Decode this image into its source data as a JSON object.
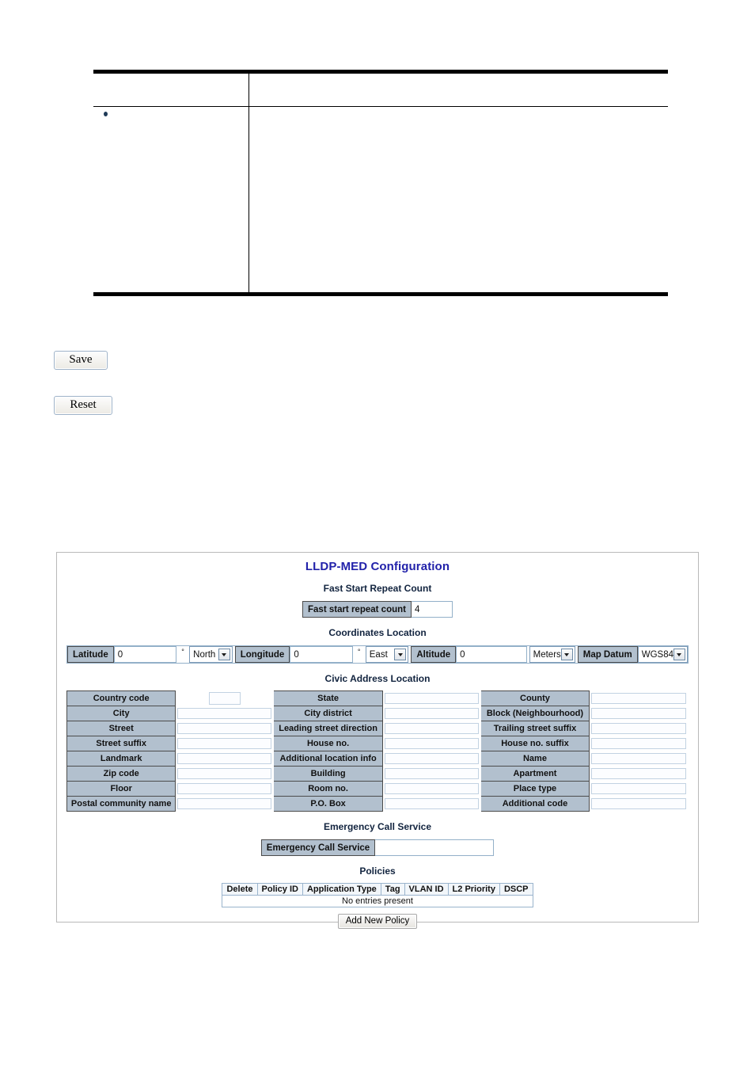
{
  "document_table": {
    "header_cells": [
      "",
      ""
    ],
    "body_rows": [
      {
        "bullet": "•",
        "left": "",
        "right": ""
      }
    ]
  },
  "actions": {
    "save_label": "Save",
    "reset_label": "Reset"
  },
  "panel": {
    "title": "LLDP-MED Configuration",
    "sections": {
      "fast_start": {
        "heading": "Fast Start Repeat Count",
        "field_label": "Fast start repeat count",
        "field_value": "4"
      },
      "coordinates": {
        "heading": "Coordinates Location",
        "latitude_label": "Latitude",
        "latitude_value": "0",
        "latitude_degree_symbol": "°",
        "latitude_direction": "North",
        "longitude_label": "Longitude",
        "longitude_value": "0",
        "longitude_degree_symbol": "°",
        "longitude_direction": "East",
        "altitude_label": "Altitude",
        "altitude_value": "0",
        "altitude_unit": "Meters",
        "map_datum_label": "Map Datum",
        "map_datum_value": "WGS84"
      },
      "civic": {
        "heading": "Civic Address Location",
        "rows": [
          {
            "c1": "Country code",
            "v1": "",
            "c2": "State",
            "v2": "",
            "c3": "County",
            "v3": ""
          },
          {
            "c1": "City",
            "v1": "",
            "c2": "City district",
            "v2": "",
            "c3": "Block (Neighbourhood)",
            "v3": ""
          },
          {
            "c1": "Street",
            "v1": "",
            "c2": "Leading street direction",
            "v2": "",
            "c3": "Trailing street suffix",
            "v3": ""
          },
          {
            "c1": "Street suffix",
            "v1": "",
            "c2": "House no.",
            "v2": "",
            "c3": "House no. suffix",
            "v3": ""
          },
          {
            "c1": "Landmark",
            "v1": "",
            "c2": "Additional location info",
            "v2": "",
            "c3": "Name",
            "v3": ""
          },
          {
            "c1": "Zip code",
            "v1": "",
            "c2": "Building",
            "v2": "",
            "c3": "Apartment",
            "v3": ""
          },
          {
            "c1": "Floor",
            "v1": "",
            "c2": "Room no.",
            "v2": "",
            "c3": "Place type",
            "v3": ""
          },
          {
            "c1": "Postal community name",
            "v1": "",
            "c2": "P.O. Box",
            "v2": "",
            "c3": "Additional code",
            "v3": ""
          }
        ]
      },
      "emergency": {
        "heading": "Emergency Call Service",
        "field_label": "Emergency Call Service",
        "field_value": ""
      },
      "policies": {
        "heading": "Policies",
        "columns": [
          "Delete",
          "Policy ID",
          "Application Type",
          "Tag",
          "VLAN ID",
          "L2 Priority",
          "DSCP"
        ],
        "empty_text": "No entries present",
        "add_button_label": "Add New Policy"
      }
    }
  },
  "colors": {
    "panel_title": "#2222aa",
    "section_heading": "#12243f",
    "label_cell_bg": "#b2c0ce",
    "input_border": "#93b0c9",
    "panel_border": "#b9b9b9"
  }
}
